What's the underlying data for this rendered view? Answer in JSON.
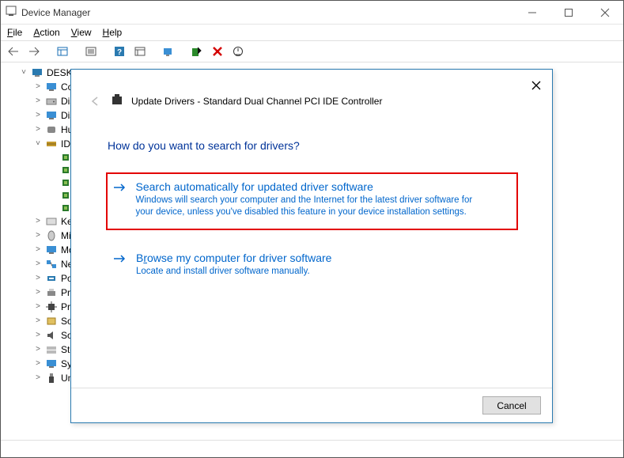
{
  "window": {
    "title": "Device Manager"
  },
  "menus": {
    "file": "File",
    "action": "Action",
    "view": "View",
    "help": "Help"
  },
  "tree": {
    "root": "DESKTO",
    "children": [
      {
        "label": "Co",
        "icon": "monitor"
      },
      {
        "label": "Disl",
        "icon": "drive"
      },
      {
        "label": "Disp",
        "icon": "monitor"
      },
      {
        "label": "Hu",
        "icon": "hid"
      },
      {
        "label": "IDE",
        "icon": "ide",
        "expanded": true,
        "children": [
          {
            "icon": "chip"
          },
          {
            "icon": "chip"
          },
          {
            "icon": "chip"
          },
          {
            "icon": "chip"
          },
          {
            "icon": "chip"
          }
        ]
      },
      {
        "label": "Key",
        "icon": "keyboard"
      },
      {
        "label": "Mic",
        "icon": "mouse"
      },
      {
        "label": "Mo",
        "icon": "monitor"
      },
      {
        "label": "Net",
        "icon": "network"
      },
      {
        "label": "Poi",
        "icon": "port"
      },
      {
        "label": "Pri",
        "icon": "printer"
      },
      {
        "label": "Pro",
        "icon": "cpu"
      },
      {
        "label": "Sof",
        "icon": "soft"
      },
      {
        "label": "Sou",
        "icon": "sound"
      },
      {
        "label": "Sto",
        "icon": "storage"
      },
      {
        "label": "Sys",
        "icon": "system"
      },
      {
        "label": "Uni",
        "icon": "usb"
      }
    ]
  },
  "wizard": {
    "title": "Update Drivers - Standard Dual Channel PCI IDE Controller",
    "heading": "How do you want to search for drivers?",
    "option1": {
      "title": "Search automatically for updated driver software",
      "desc": "Windows will search your computer and the Internet for the latest driver software for your device, unless you've disabled this feature in your device installation settings."
    },
    "option2": {
      "title": "Browse my computer for driver software",
      "desc": "Locate and install driver software manually."
    },
    "cancel": "Cancel"
  }
}
